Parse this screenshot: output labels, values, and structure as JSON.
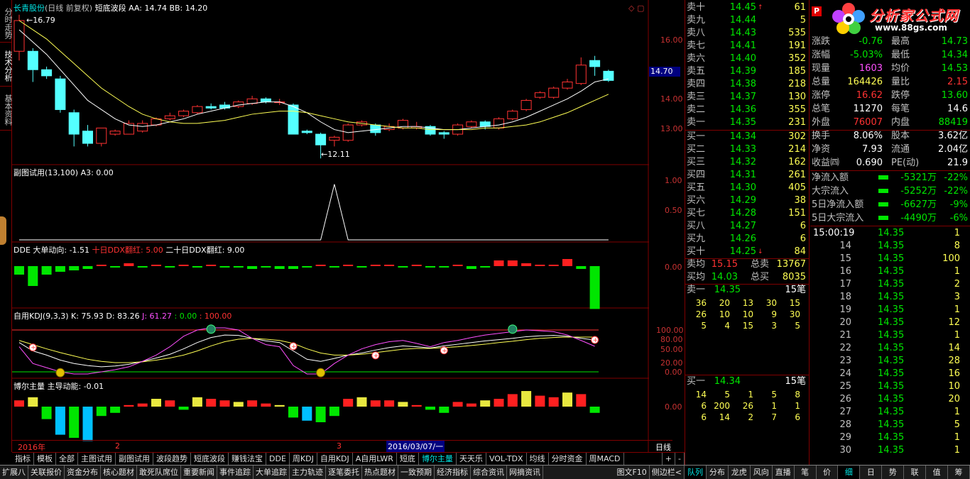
{
  "left_tabs": [
    "分时走势",
    "技术分析",
    "基本资料"
  ],
  "main_panel": {
    "stock_name": "长青股份",
    "period": "(日线 前复权)",
    "indicator": "短底波段",
    "aa_label": "AA: 14.74",
    "bb_label": "BB: 14.20",
    "high_mark": "16.79",
    "low_mark": "12.11",
    "axis_ticks": [
      "16.00",
      "14.00",
      "13.00"
    ],
    "current_price_tag": "14.70"
  },
  "sub1": {
    "title": "副图试用(13,100)",
    "a3": "A3: 0.00",
    "ticks": [
      "1.00",
      "0.50"
    ]
  },
  "sub2": {
    "title": "DDE",
    "l1": "大单动向: -1.51",
    "l2": "十日DDX翻红: 5.00",
    "l3": "二十日DDX翻红: 9.00",
    "ticks": [
      "0.00"
    ]
  },
  "sub3": {
    "title": "自用KDJ(9,3,3)",
    "k": "K: 75.93",
    "d": "D: 83.26",
    "j": "J: 61.27",
    "z1": ": 0.00",
    "z2": ": 100.00",
    "ticks": [
      "100.00",
      "80.00",
      "50.00",
      "20.00",
      "0.00"
    ]
  },
  "sub4": {
    "title": "博尔主量",
    "l1": "主导动能: -0.01",
    "ticks": [
      "0.00"
    ]
  },
  "time_axis": {
    "l1": "2016年",
    "l2": "2",
    "l3": "3",
    "cursor": "2016/03/07/一",
    "period_label": "日线"
  },
  "tabs": [
    "指标",
    "模板",
    "全部",
    "主图试用",
    "副图试用",
    "波段趋势",
    "短底波段",
    "赚钱法宝",
    "DDE",
    "周KDJ",
    "自用KDJ",
    "A自用LWR",
    "短底",
    "博尔主量",
    "天天乐",
    "VOL-TDX",
    "均线",
    "分时资金",
    "周MACD"
  ],
  "tab_ctrl": [
    "+",
    "-"
  ],
  "bottom_tabs": [
    "扩展八",
    "关联报价",
    "资金分布",
    "核心题材",
    "敢死队席位",
    "重要新闻",
    "事件追踪",
    "大单追踪",
    "主力轨迹",
    "逐笔委托",
    "热点题材",
    "一致预期",
    "经济指标",
    "综合资讯",
    "网摘资讯",
    "图文F10",
    "侧边栏<"
  ],
  "bottom_right_tabs": [
    "队列",
    "分布",
    "龙虎",
    "风向",
    "直播",
    "笔",
    "价",
    "细",
    "日",
    "势",
    "联",
    "值",
    "筹"
  ],
  "sells": [
    {
      "label": "卖十",
      "price": "14.45",
      "vol": "61",
      "arrow": "↑"
    },
    {
      "label": "卖九",
      "price": "14.44",
      "vol": "5"
    },
    {
      "label": "卖八",
      "price": "14.43",
      "vol": "535"
    },
    {
      "label": "卖七",
      "price": "14.41",
      "vol": "191"
    },
    {
      "label": "卖六",
      "price": "14.40",
      "vol": "352"
    },
    {
      "label": "卖五",
      "price": "14.39",
      "vol": "185"
    },
    {
      "label": "卖四",
      "price": "14.38",
      "vol": "218"
    },
    {
      "label": "卖三",
      "price": "14.37",
      "vol": "130"
    },
    {
      "label": "卖二",
      "price": "14.36",
      "vol": "355"
    },
    {
      "label": "卖一",
      "price": "14.35",
      "vol": "231"
    }
  ],
  "buys": [
    {
      "label": "买一",
      "price": "14.34",
      "vol": "302"
    },
    {
      "label": "买二",
      "price": "14.33",
      "vol": "214"
    },
    {
      "label": "买三",
      "price": "14.32",
      "vol": "162"
    },
    {
      "label": "买四",
      "price": "14.31",
      "vol": "261"
    },
    {
      "label": "买五",
      "price": "14.30",
      "vol": "405"
    },
    {
      "label": "买六",
      "price": "14.29",
      "vol": "38"
    },
    {
      "label": "买七",
      "price": "14.28",
      "vol": "151"
    },
    {
      "label": "买八",
      "price": "14.27",
      "vol": "6"
    },
    {
      "label": "买九",
      "price": "14.26",
      "vol": "6"
    },
    {
      "label": "买十",
      "price": "14.25",
      "vol": "84",
      "arrow": "↓"
    }
  ],
  "avg": {
    "sell_avg_label": "卖均",
    "sell_avg": "15.15",
    "total_sell_label": "总卖",
    "total_sell": "13767",
    "buy_avg_label": "买均",
    "buy_avg": "14.03",
    "total_buy_label": "总买",
    "total_buy": "8035"
  },
  "queue_sell": {
    "label": "卖一",
    "price": "14.35",
    "count": "15笔",
    "rows": [
      [
        "36",
        "20",
        "13",
        "30",
        "15"
      ],
      [
        "26",
        "10",
        "10",
        "9",
        "30"
      ],
      [
        "5",
        "4",
        "15",
        "3",
        "5"
      ]
    ]
  },
  "queue_buy": {
    "label": "买一",
    "price": "14.34",
    "count": "15笔",
    "rows": [
      [
        "14",
        "5",
        "1",
        "5",
        "8"
      ],
      [
        "6",
        "200",
        "26",
        "1",
        "1"
      ],
      [
        "6",
        "14",
        "2",
        "7",
        "6"
      ]
    ]
  },
  "logo": {
    "p": "P",
    "title": "分析家公式网",
    "url": "www.88gs.com"
  },
  "stats": [
    {
      "l1": "现价",
      "v1": "",
      "l2": "",
      "v2": ""
    },
    {
      "l1": "涨跌",
      "v1": "-0.76",
      "c1": "grn",
      "l2": "最高",
      "v2": "14.73",
      "c2": "grn"
    },
    {
      "l1": "涨幅",
      "v1": "-5.03%",
      "c1": "grn",
      "l2": "最低",
      "v2": "14.34",
      "c2": "grn"
    },
    {
      "l1": "现量",
      "v1": "1603",
      "c1": "mag",
      "l2": "均价",
      "v2": "14.53",
      "c2": "grn"
    },
    {
      "l1": "总量",
      "v1": "164426",
      "c1": "yel",
      "l2": "量比",
      "v2": "2.15",
      "c2": "red"
    },
    {
      "l1": "涨停",
      "v1": "16.62",
      "c1": "red",
      "l2": "跌停",
      "v2": "13.60",
      "c2": "grn"
    },
    {
      "l1": "总笔",
      "v1": "11270",
      "c1": "wht",
      "l2": "每笔",
      "v2": "14.6",
      "c2": "wht"
    },
    {
      "l1": "外盘",
      "v1": "76007",
      "c1": "red",
      "l2": "内盘",
      "v2": "88419",
      "c2": "grn"
    },
    {
      "l1": "换手",
      "v1": "8.06%",
      "c1": "wht",
      "l2": "股本",
      "v2": "3.62亿",
      "c2": "wht"
    },
    {
      "l1": "净资",
      "v1": "7.93",
      "c1": "wht",
      "l2": "流通",
      "v2": "2.04亿",
      "c2": "wht"
    },
    {
      "l1": "收益㈣",
      "v1": "0.690",
      "c1": "wht",
      "l2": "PE(动)",
      "v2": "21.9",
      "c2": "wht"
    }
  ],
  "flows": [
    {
      "label": "净流入额",
      "value": "-5321万",
      "pct": "-22%"
    },
    {
      "label": "大宗流入",
      "value": "-5252万",
      "pct": "-22%"
    },
    {
      "label": "5日净流入额",
      "value": "-6627万",
      "pct": "-9%"
    },
    {
      "label": "5日大宗流入",
      "value": "-4490万",
      "pct": "-6%"
    }
  ],
  "ticks": [
    {
      "t": "15:00:19",
      "p": "14.35",
      "v": "1"
    },
    {
      "t": "14",
      "p": "14.35",
      "v": "8"
    },
    {
      "t": "15",
      "p": "14.35",
      "v": "100"
    },
    {
      "t": "16",
      "p": "14.35",
      "v": "1"
    },
    {
      "t": "17",
      "p": "14.35",
      "v": "2"
    },
    {
      "t": "18",
      "p": "14.35",
      "v": "3"
    },
    {
      "t": "19",
      "p": "14.35",
      "v": "1"
    },
    {
      "t": "20",
      "p": "14.35",
      "v": "12"
    },
    {
      "t": "21",
      "p": "14.35",
      "v": "1"
    },
    {
      "t": "22",
      "p": "14.35",
      "v": "14"
    },
    {
      "t": "23",
      "p": "14.35",
      "v": "28"
    },
    {
      "t": "24",
      "p": "14.35",
      "v": "16"
    },
    {
      "t": "25",
      "p": "14.35",
      "v": "10"
    },
    {
      "t": "26",
      "p": "14.35",
      "v": "20"
    },
    {
      "t": "27",
      "p": "14.35",
      "v": "1"
    },
    {
      "t": "28",
      "p": "14.35",
      "v": "5"
    },
    {
      "t": "29",
      "p": "14.35",
      "v": "1"
    },
    {
      "t": "30",
      "p": "14.35",
      "v": "1"
    }
  ],
  "chart_data": [
    {
      "type": "candlestick",
      "title": "长青股份 (日线 前复权) 短底波段",
      "ylim": [
        12.0,
        16.9
      ],
      "candles": [
        {
          "o": 15.6,
          "c": 16.6,
          "h": 16.79,
          "l": 15.3
        },
        {
          "o": 15.6,
          "c": 15.0,
          "h": 15.7,
          "l": 14.6
        },
        {
          "o": 15.0,
          "c": 14.8,
          "h": 15.1,
          "l": 14.7
        },
        {
          "o": 14.7,
          "c": 13.7,
          "h": 14.8,
          "l": 13.6
        },
        {
          "o": 13.6,
          "c": 12.9,
          "h": 13.7,
          "l": 12.5
        },
        {
          "o": 13.0,
          "c": 12.6,
          "h": 13.2,
          "l": 12.5
        },
        {
          "o": 12.6,
          "c": 13.1,
          "h": 13.1,
          "l": 12.5
        },
        {
          "o": 12.9,
          "c": 13.0,
          "h": 13.05,
          "l": 12.85
        },
        {
          "o": 12.9,
          "c": 13.25,
          "h": 13.35,
          "l": 12.9
        },
        {
          "o": 13.0,
          "c": 13.25,
          "h": 13.35,
          "l": 12.95
        },
        {
          "o": 13.2,
          "c": 13.4,
          "h": 13.45,
          "l": 13.15
        },
        {
          "o": 13.4,
          "c": 13.5,
          "h": 13.6,
          "l": 13.35
        },
        {
          "o": 13.5,
          "c": 13.65,
          "h": 13.7,
          "l": 13.45
        },
        {
          "o": 13.6,
          "c": 13.8,
          "h": 13.85,
          "l": 13.55
        },
        {
          "o": 13.8,
          "c": 13.75,
          "h": 13.9,
          "l": 13.7
        },
        {
          "o": 13.85,
          "c": 13.75,
          "h": 13.95,
          "l": 13.7
        },
        {
          "o": 13.8,
          "c": 13.95,
          "h": 14.0,
          "l": 13.75
        },
        {
          "o": 13.9,
          "c": 14.05,
          "h": 14.15,
          "l": 13.85
        },
        {
          "o": 14.05,
          "c": 13.95,
          "h": 14.1,
          "l": 13.9
        },
        {
          "o": 13.95,
          "c": 13.95,
          "h": 14.05,
          "l": 13.85
        },
        {
          "o": 13.85,
          "c": 12.9,
          "h": 13.9,
          "l": 12.9
        },
        {
          "o": 13.0,
          "c": 12.95,
          "h": 13.05,
          "l": 12.9
        },
        {
          "o": 12.9,
          "c": 12.55,
          "h": 12.95,
          "l": 12.11
        },
        {
          "o": 12.7,
          "c": 12.8,
          "h": 12.85,
          "l": 12.5
        },
        {
          "o": 12.7,
          "c": 13.2,
          "h": 13.25,
          "l": 12.65
        },
        {
          "o": 13.2,
          "c": 13.3,
          "h": 13.35,
          "l": 13.15
        },
        {
          "o": 13.2,
          "c": 12.95,
          "h": 13.25,
          "l": 12.85
        },
        {
          "o": 13.05,
          "c": 13.15,
          "h": 13.25,
          "l": 13.0
        },
        {
          "o": 13.1,
          "c": 13.35,
          "h": 13.4,
          "l": 13.05
        },
        {
          "o": 13.1,
          "c": 13.15,
          "h": 13.3,
          "l": 13.05
        },
        {
          "o": 13.15,
          "c": 12.9,
          "h": 13.2,
          "l": 12.85
        },
        {
          "o": 12.95,
          "c": 12.9,
          "h": 13.0,
          "l": 12.75
        },
        {
          "o": 12.9,
          "c": 13.2,
          "h": 13.25,
          "l": 12.85
        },
        {
          "o": 13.15,
          "c": 13.3,
          "h": 13.35,
          "l": 13.1
        },
        {
          "o": 13.3,
          "c": 13.15,
          "h": 13.35,
          "l": 13.05
        },
        {
          "o": 13.1,
          "c": 13.4,
          "h": 13.45,
          "l": 13.05
        },
        {
          "o": 13.4,
          "c": 13.65,
          "h": 13.7,
          "l": 13.35
        },
        {
          "o": 13.7,
          "c": 14.0,
          "h": 14.05,
          "l": 13.65
        },
        {
          "o": 14.1,
          "c": 14.25,
          "h": 14.3,
          "l": 14.05
        },
        {
          "o": 14.1,
          "c": 14.4,
          "h": 14.45,
          "l": 14.05
        },
        {
          "o": 14.4,
          "c": 14.6,
          "h": 14.7,
          "l": 14.35
        },
        {
          "o": 14.55,
          "c": 15.15,
          "h": 15.4,
          "l": 14.5
        },
        {
          "o": 15.3,
          "c": 15.1,
          "h": 15.45,
          "l": 14.8
        },
        {
          "o": 14.95,
          "c": 14.65,
          "h": 15.0,
          "l": 14.6
        }
      ],
      "ma_short": [
        16.3,
        15.9,
        15.5,
        15.0,
        14.5,
        14.0,
        13.7,
        13.4,
        13.2,
        13.15,
        13.2,
        13.3,
        13.4,
        13.55,
        13.65,
        13.75,
        13.85,
        13.9,
        13.95,
        13.95,
        13.8,
        13.6,
        13.3,
        13.05,
        12.95,
        13.0,
        13.05,
        13.1,
        13.15,
        13.15,
        13.1,
        13.05,
        13.05,
        13.1,
        13.15,
        13.2,
        13.3,
        13.45,
        13.65,
        13.85,
        14.05,
        14.3,
        14.6,
        14.7
      ],
      "ma_long": [
        16.6,
        16.3,
        16.0,
        15.6,
        15.2,
        14.8,
        14.4,
        14.1,
        13.8,
        13.55,
        13.4,
        13.3,
        13.25,
        13.25,
        13.3,
        13.35,
        13.45,
        13.55,
        13.6,
        13.65,
        13.65,
        13.6,
        13.5,
        13.4,
        13.3,
        13.25,
        13.2,
        13.15,
        13.1,
        13.1,
        13.05,
        13.05,
        13.05,
        13.05,
        13.1,
        13.1,
        13.15,
        13.2,
        13.3,
        13.45,
        13.6,
        13.8,
        14.0,
        14.2
      ]
    },
    {
      "type": "line",
      "title": "副图试用(13,100)",
      "ylim": [
        0,
        1.2
      ],
      "values": [
        0,
        0,
        0,
        0,
        0,
        0,
        0,
        0,
        0,
        0,
        0,
        0,
        0,
        0,
        0,
        0,
        0,
        0,
        0,
        0,
        0,
        0,
        0,
        1.0,
        0,
        0,
        0,
        0,
        0,
        0,
        0,
        0,
        0,
        0,
        0,
        0,
        0,
        0,
        0,
        0,
        0,
        0,
        0,
        0
      ]
    },
    {
      "type": "bar",
      "title": "DDE",
      "values": [
        -0.3,
        -0.7,
        -0.3,
        -0.2,
        -0.15,
        -0.1,
        0.05,
        -0.05,
        0.1,
        -0.05,
        0.05,
        -0.05,
        0.05,
        -0.05,
        0.05,
        -0.05,
        -0.05,
        -0.1,
        -0.05,
        -0.1,
        -0.1,
        -0.05,
        0.05,
        -0.05,
        0.05,
        -0.05,
        0.05,
        0.05,
        -0.05,
        0.05,
        -0.05,
        -0.05,
        0.05,
        -0.1,
        -0.05,
        0.2,
        0.2,
        0.1,
        0.05,
        0.05,
        0.25,
        -0.1,
        -1.51
      ]
    },
    {
      "type": "line",
      "title": "自用KDJ(9,3,3)",
      "ylim": [
        0,
        100
      ],
      "series": [
        {
          "name": "K",
          "values": [
            70,
            50,
            40,
            28,
            20,
            15,
            12,
            14,
            18,
            25,
            33,
            42,
            55,
            70,
            82,
            88,
            87,
            80,
            74,
            70,
            50,
            30,
            25,
            32,
            40,
            45,
            52,
            58,
            62,
            60,
            57,
            62,
            66,
            70,
            74,
            77,
            80,
            84,
            86,
            87,
            85,
            80,
            76
          ]
        },
        {
          "name": "D",
          "values": [
            75,
            65,
            55,
            46,
            38,
            30,
            25,
            22,
            22,
            24,
            28,
            33,
            40,
            50,
            62,
            72,
            78,
            80,
            78,
            75,
            68,
            55,
            45,
            40,
            40,
            42,
            46,
            50,
            54,
            56,
            56,
            58,
            60,
            63,
            66,
            70,
            73,
            77,
            80,
            82,
            83,
            83,
            83
          ]
        },
        {
          "name": "J",
          "values": [
            60,
            20,
            10,
            0,
            -5,
            -5,
            0,
            5,
            12,
            25,
            40,
            60,
            85,
            100,
            110,
            108,
            100,
            80,
            65,
            60,
            15,
            -10,
            -5,
            20,
            40,
            55,
            65,
            72,
            75,
            68,
            60,
            70,
            75,
            82,
            88,
            92,
            96,
            100,
            98,
            96,
            88,
            75,
            61
          ]
        }
      ]
    },
    {
      "type": "bar",
      "title": "博尔主量",
      "values": [
        0.2,
        0.3,
        -0.4,
        -0.9,
        -1.0,
        -1.1,
        -0.3,
        -0.2,
        0.05,
        0.1,
        0.25,
        0.2,
        -0.1,
        0.3,
        0.25,
        0.2,
        0.15,
        0.2,
        0.1,
        0.05,
        -0.35,
        -0.45,
        -0.5,
        -0.3,
        0.25,
        0.3,
        0.2,
        0.2,
        0.15,
        0.05,
        -0.1,
        -0.2,
        0.15,
        0.1,
        0.2,
        0.25,
        0.4,
        0.5,
        0.35,
        0.3,
        0.45,
        0.4,
        -0.2
      ]
    }
  ]
}
